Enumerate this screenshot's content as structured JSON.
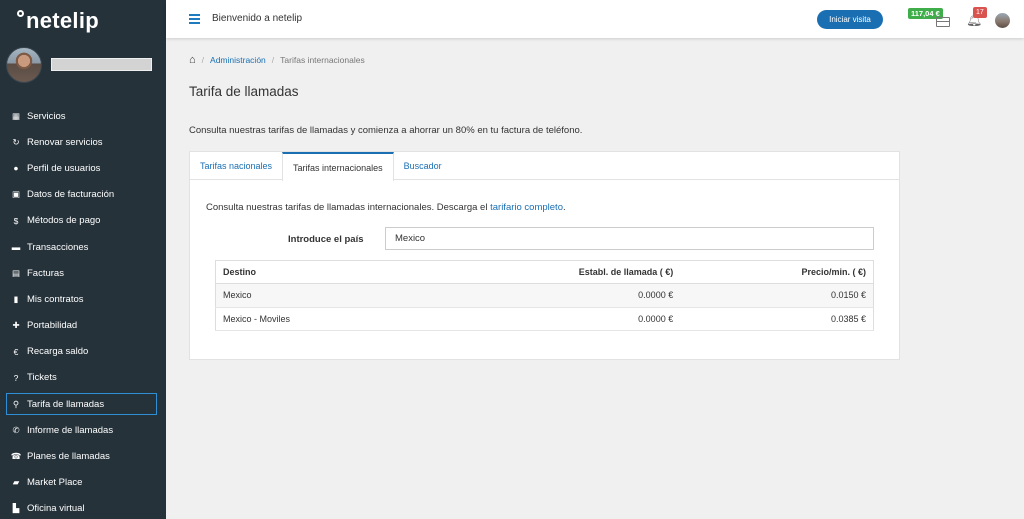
{
  "brand": {
    "name": "netelip"
  },
  "sidebar": {
    "items": [
      {
        "label": "Servicios",
        "icon": "grid-icon"
      },
      {
        "label": "Renovar servicios",
        "icon": "refresh-icon"
      },
      {
        "label": "Perfil de usuarios",
        "icon": "user-icon"
      },
      {
        "label": "Datos de facturación",
        "icon": "briefcase-icon"
      },
      {
        "label": "Métodos de pago",
        "icon": "dollar-icon"
      },
      {
        "label": "Transacciones",
        "icon": "card-icon"
      },
      {
        "label": "Facturas",
        "icon": "invoice-icon"
      },
      {
        "label": "Mis contratos",
        "icon": "document-icon"
      },
      {
        "label": "Portabilidad",
        "icon": "plus-icon"
      },
      {
        "label": "Recarga saldo",
        "icon": "euro-icon"
      },
      {
        "label": "Tickets",
        "icon": "question-icon"
      },
      {
        "label": "Tarifa de llamadas",
        "icon": "search-icon",
        "active": true
      },
      {
        "label": "Informe de llamadas",
        "icon": "phone-icon"
      },
      {
        "label": "Planes de llamadas",
        "icon": "phone-plan-icon"
      },
      {
        "label": "Market Place",
        "icon": "market-icon"
      },
      {
        "label": "Oficina virtual",
        "icon": "office-icon"
      }
    ]
  },
  "topbar": {
    "welcome": "Bienvenido a netelip",
    "visit_button": "Iniciar visita",
    "balance": "117,04 €",
    "notifications": "17"
  },
  "breadcrumb": {
    "admin": "Administración",
    "current": "Tarifas internacionales"
  },
  "page": {
    "title": "Tarifa de llamadas",
    "intro": "Consulta nuestras tarifas de llamadas y comienza a ahorrar un 80% en tu factura de teléfono."
  },
  "tabs": [
    {
      "label": "Tarifas nacionales"
    },
    {
      "label": "Tarifas internacionales",
      "active": true
    },
    {
      "label": "Buscador"
    }
  ],
  "international": {
    "desc_prefix": "Consulta nuestras tarifas de llamadas internacionales. Descarga el ",
    "desc_link": "tarifario completo",
    "desc_suffix": ".",
    "country_label": "Introduce el país",
    "country_value": "Mexico",
    "columns": [
      "Destino",
      "Establ. de llamada ( €)",
      "Precio/min. ( €)"
    ],
    "rows": [
      [
        "Mexico",
        "0.0000 €",
        "0.0150 €"
      ],
      [
        "Mexico - Moviles",
        "0.0000 €",
        "0.0385 €"
      ]
    ]
  },
  "colors": {
    "sidebar_bg": "#25323a",
    "accent": "#1a6fb3",
    "balance_bg": "#3fae4a",
    "notif_bg": "#d9534f"
  }
}
